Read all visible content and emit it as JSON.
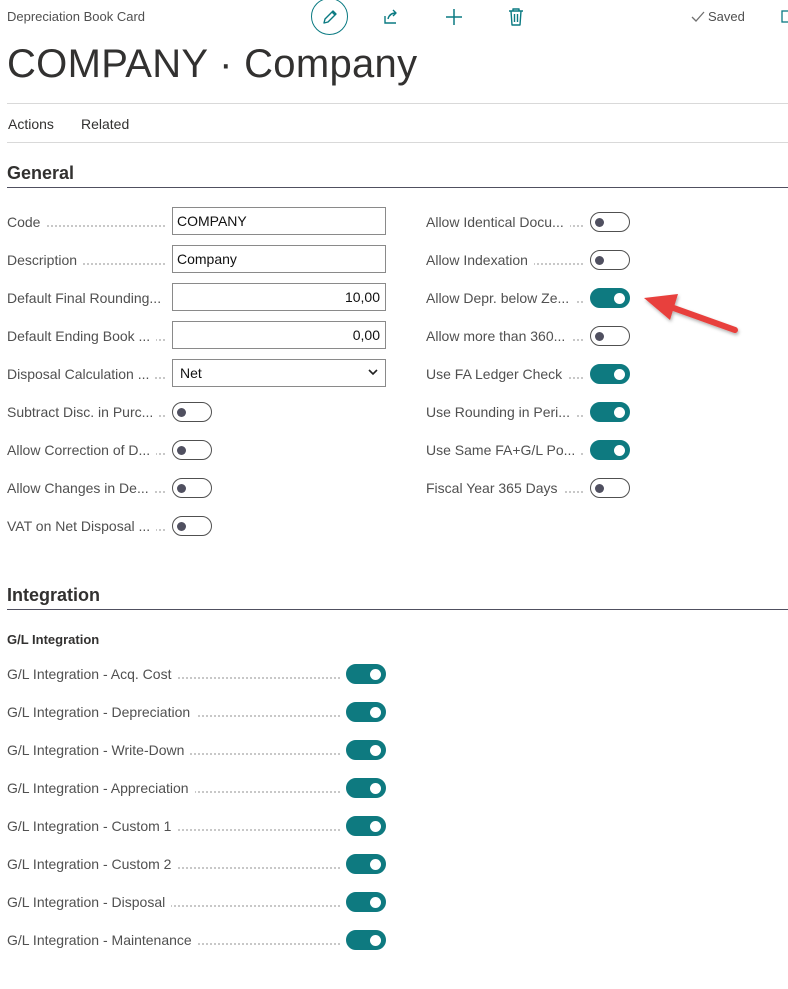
{
  "header": {
    "page_kind": "Depreciation Book Card",
    "saved_label": "Saved",
    "title": "COMPANY · Company"
  },
  "actionbar": {
    "items": [
      "Actions",
      "Related"
    ]
  },
  "general": {
    "heading": "General",
    "left_fields": [
      {
        "label": "Code",
        "type": "text",
        "value": "COMPANY"
      },
      {
        "label": "Description",
        "type": "text",
        "value": "Company"
      },
      {
        "label": "Default Final Rounding...",
        "type": "number",
        "value": "10,00"
      },
      {
        "label": "Default Ending Book ...",
        "type": "number",
        "value": "0,00"
      },
      {
        "label": "Disposal Calculation ...",
        "type": "select",
        "value": "Net"
      },
      {
        "label": "Subtract Disc. in Purc...",
        "type": "toggle",
        "value": false
      },
      {
        "label": "Allow Correction of D...",
        "type": "toggle",
        "value": false
      },
      {
        "label": "Allow Changes in De...",
        "type": "toggle",
        "value": false
      },
      {
        "label": "VAT on Net Disposal ...",
        "type": "toggle",
        "value": false
      }
    ],
    "right_fields": [
      {
        "label": "Allow Identical Docu...",
        "value": false
      },
      {
        "label": "Allow Indexation",
        "value": false
      },
      {
        "label": "Allow Depr. below Ze...",
        "value": true
      },
      {
        "label": "Allow more than 360...",
        "value": false
      },
      {
        "label": "Use FA Ledger Check",
        "value": true
      },
      {
        "label": "Use Rounding in Peri...",
        "value": true
      },
      {
        "label": "Use Same FA+G/L Po...",
        "value": true
      },
      {
        "label": "Fiscal Year 365 Days",
        "value": false
      }
    ]
  },
  "integration": {
    "heading": "Integration",
    "subheading": "G/L Integration",
    "fields": [
      {
        "label": "G/L Integration - Acq. Cost",
        "value": true
      },
      {
        "label": "G/L Integration - Depreciation",
        "value": true
      },
      {
        "label": "G/L Integration - Write-Down",
        "value": true
      },
      {
        "label": "G/L Integration - Appreciation",
        "value": true
      },
      {
        "label": "G/L Integration - Custom 1",
        "value": true
      },
      {
        "label": "G/L Integration - Custom 2",
        "value": true
      },
      {
        "label": "G/L Integration - Disposal",
        "value": true
      },
      {
        "label": "G/L Integration - Maintenance",
        "value": true
      }
    ]
  },
  "colors": {
    "accent": "#0e7a80",
    "annotation_arrow": "#e8413c"
  },
  "icons": [
    "edit-icon",
    "share-icon",
    "add-icon",
    "delete-icon",
    "checkmark-icon",
    "chevron-down-icon"
  ]
}
